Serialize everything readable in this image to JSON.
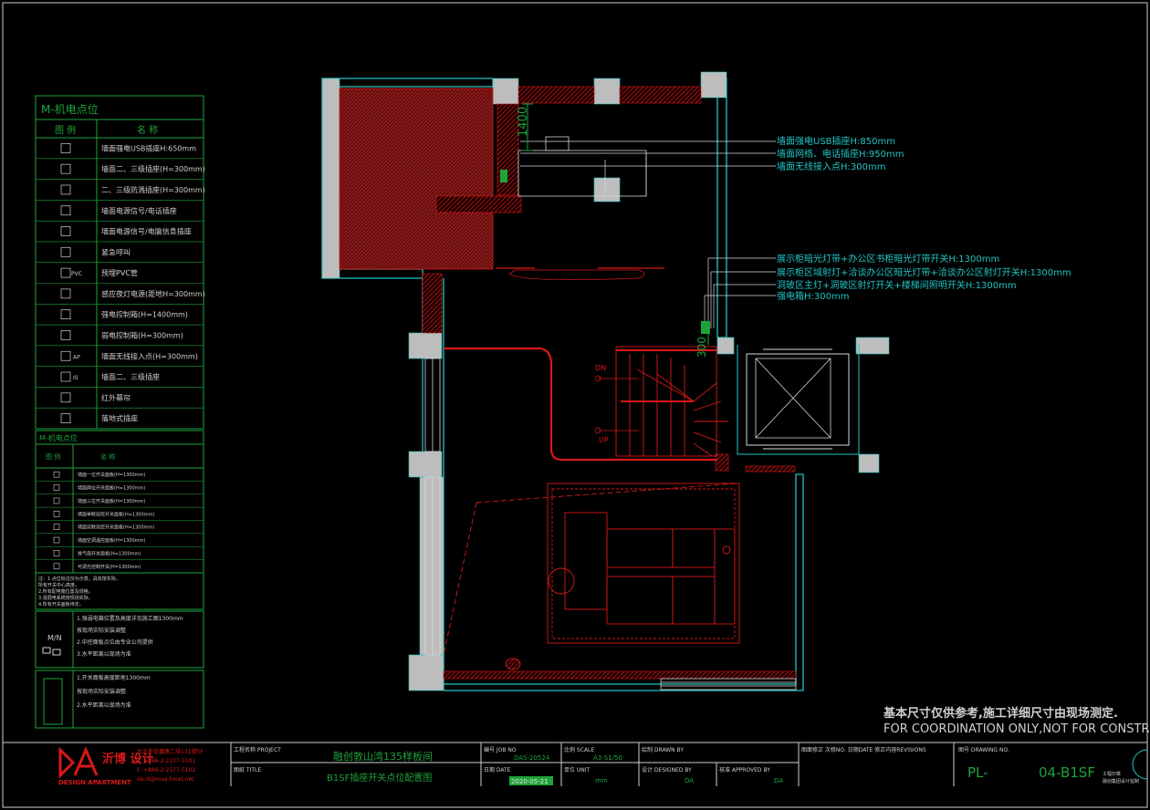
{
  "legend_power": {
    "title": "M-机电点位",
    "col_icon": "图 例",
    "col_name": "名 称",
    "rows": [
      "墙面强电USB插座H:650mm",
      "墙面二、三级插座(H=300mm)",
      "二、三级防溅插座(H=300mm)",
      "墙面电源信号/电话插座",
      "墙面电源信号/电脑信息插座",
      "紧急呼叫",
      "预埋PVC管",
      "感应夜灯电源(距地H=300mm)",
      "强电控制箱(H=1400mm)",
      "弱电控制箱(H=300mm)",
      "墙面无线接入点(H=300mm)",
      "墙面二、三级插座",
      "红外幕帘",
      "落地式插座"
    ],
    "icon_texts": [
      "PVC",
      "AP",
      "IS"
    ]
  },
  "legend_switch": {
    "title": "M-机电点位",
    "col_icon": "图 例",
    "col_name": "名 称",
    "rows": [
      "墙面一位开关面板(H=1300mm)",
      "墙面两位开关面板(H=1300mm)",
      "墙面三位开关面板(H=1300mm)",
      "墙面单联双控开关面板(H=1300mm)",
      "墙面双联双控开关面板(H=1300mm)",
      "墙面空调温控面板(H=1300mm)",
      "排气扇开关面板(H=1300mm)",
      "可调光控制开关(H=1300mm)"
    ],
    "notes": [
      "注：1.点位标注仅为示意，具体按实际。",
      "  所有开关中心高度。",
      "  2.所有配电箱位置及规格。",
      "  3.强弱电系统按现场实际。",
      "  4.所有开关面板待定。"
    ]
  },
  "mini_notes_1": [
    "1.强弱电箱位置及高度详见施工图1300mm",
    "  按现场实际安装调整",
    "2.中控面板点位由专业公司提供",
    "3.水平距离以现场为准"
  ],
  "mini_notes_1_label": "M/N",
  "mini_notes_2": [
    "1.开关面板高度距地1300mm",
    "  按现场实际安装调整",
    "2.水平距离以现场为准"
  ],
  "plan": {
    "dim_1400": "1400",
    "dim_300": "300",
    "stair_dn": "DN",
    "stair_up": "UP",
    "callouts_top": [
      "墙面强电USB插座H:850mm",
      "墙面网络、电话插座H:950mm",
      "墙面无线接入点H:300mm"
    ],
    "callouts_mid": [
      "展示柜暗光灯带+办公区书柜暗光灯带开关H:1300mm",
      "展示柜区域射灯+洽谈办公区暗光灯带+洽谈办公区射灯开关H:1300mm",
      "洞玻区主灯+洞玻区射灯开关+楼梯间照明开关H:1300mm",
      "强电箱H:300mm"
    ]
  },
  "disclaimer_cn": "基本尺寸仅供参考,施工详细尺寸由现场测定.",
  "disclaimer_en": "FOR COORDINATION ONLY,NOT FOR CONSTRUCT",
  "title_block": {
    "logo_mark": "DA",
    "logo_cn": "沂博 设计",
    "logo_en": "DESIGN APARTMENT",
    "company_lines": [
      "台北市信義路二段131號5F",
      "T: +886-2-2377-5101",
      "F: +886-2-2377-5102",
      "da.id@msa.hinet.net"
    ],
    "project_label": "工程名称 PROJECT",
    "project": "融创敦山湾135样板间",
    "title_label": "图纸 TITLE",
    "title": "B1SF插座开关点位配置图",
    "job_label": "编号 JOB NO",
    "job": "DAS-20524",
    "scale_label": "比例 SCALE",
    "scale": "A3-S1/50",
    "date_label": "日期 DATE",
    "date": "2020-05-21",
    "unit_label": "单位 UNIT",
    "unit": "mm",
    "drawn_label": "绘制 DRAWN BY",
    "designed_label": "设计 DESIGNED BY",
    "designed": "DA",
    "approved_label": "核准 APPROVED BY",
    "approved": "DA",
    "revisions_label": "图面修正 次修NO. 日期DATE 修正内容REVISIONS",
    "drawing_no_label": "图号 DRAWING NO.",
    "drawing_no_a": "PL-",
    "drawing_no_b": "04-B1SF",
    "stamp_text": "工程印章",
    "stamp_sub": "融创集团设计监制"
  },
  "colors": {
    "cyan": "#23c4c4",
    "green": "#1fa43a",
    "red": "#d81818",
    "white": "#e8e8e8",
    "yellow": "#ffff66"
  }
}
